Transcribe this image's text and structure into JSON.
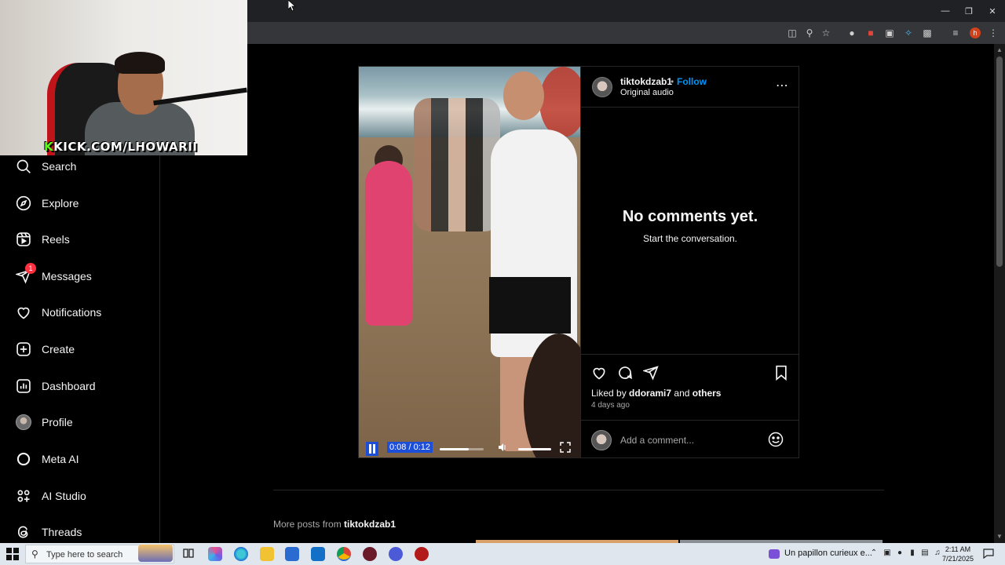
{
  "webcam": {
    "label_k": "K",
    "label_rest": "KICK.COM/LHOWARII"
  },
  "sidebar": {
    "items": [
      {
        "label": "Search",
        "icon": "search-icon"
      },
      {
        "label": "Explore",
        "icon": "compass-icon"
      },
      {
        "label": "Reels",
        "icon": "reels-icon"
      },
      {
        "label": "Messages",
        "icon": "messenger-icon",
        "badge": "1"
      },
      {
        "label": "Notifications",
        "icon": "heart-icon"
      },
      {
        "label": "Create",
        "icon": "plus-square-icon"
      },
      {
        "label": "Dashboard",
        "icon": "dashboard-icon"
      },
      {
        "label": "Profile",
        "icon": "profile-avatar"
      },
      {
        "label": "Meta AI",
        "icon": "meta-ai-icon"
      },
      {
        "label": "AI Studio",
        "icon": "ai-studio-icon"
      },
      {
        "label": "Threads",
        "icon": "threads-icon"
      }
    ]
  },
  "post": {
    "username": "tiktokdzab1",
    "separator": "•",
    "follow_label": "Follow",
    "audio": "Original audio",
    "no_comments_title": "No comments yet.",
    "no_comments_sub": "Start the conversation.",
    "liked_by_prefix": "Liked by",
    "liked_by_user": "ddorami7",
    "liked_by_and": "and",
    "liked_by_others": "others",
    "posted_ago": "4 days ago",
    "comment_placeholder": "Add a comment..."
  },
  "video": {
    "time": "0:08 / 0:12",
    "progress_fraction": 0.667
  },
  "more_posts": {
    "prefix": "More posts from",
    "username": "tiktokdzab1"
  },
  "taskbar": {
    "search_placeholder": "Type here to search",
    "notification": "Un papillon curieux e...",
    "time": "2:11 AM",
    "date": "7/21/2025"
  },
  "colors": {
    "accent_blue": "#0095f6",
    "badge_red": "#ff3040",
    "kick_green": "#53fc18"
  }
}
